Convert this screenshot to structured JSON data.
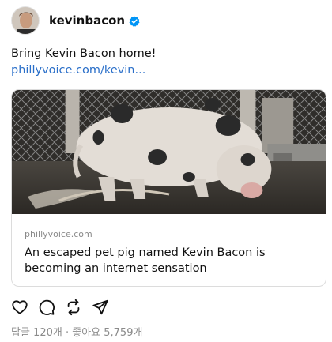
{
  "post": {
    "username": "kevinbacon",
    "text": "Bring Kevin Bacon home!",
    "link_text": "phillyvoice.com/kevin...",
    "card": {
      "domain": "phillyvoice.com",
      "title": "An escaped pet pig named Kevin Bacon is becoming an internet sensation"
    }
  },
  "actions": {
    "icons": [
      "heart-icon",
      "comment-icon",
      "repost-icon",
      "share-icon"
    ]
  },
  "stats": {
    "replies": "답글 120개",
    "separator": "·",
    "likes": "좋아요 5,759개"
  },
  "colors": {
    "link": "#2a6fc9",
    "verified": "#0095f6",
    "muted": "#8b8b8b"
  }
}
